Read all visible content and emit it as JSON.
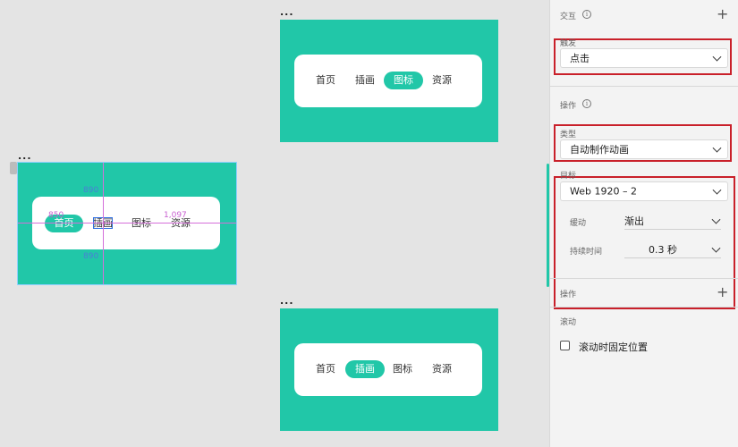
{
  "artboards": [
    {
      "label": "...",
      "nav": [
        "首页",
        "插画",
        "图标",
        "资源"
      ],
      "active_index": 2
    },
    {
      "label": "...",
      "nav": [
        "首页",
        "插画",
        "图标",
        "资源"
      ],
      "active_index": 0,
      "selected_item": "插画",
      "measurements": {
        "top": "890",
        "bottom": "890",
        "left": "850",
        "right": "1,097"
      }
    },
    {
      "label": "...",
      "nav": [
        "首页",
        "插画",
        "图标",
        "资源"
      ],
      "active_index": 1
    }
  ],
  "panel": {
    "interaction_title": "交互",
    "trigger": {
      "label": "触发",
      "value": "点击"
    },
    "action_title": "操作",
    "type": {
      "label": "类型",
      "value": "自动制作动画"
    },
    "target": {
      "label": "目标",
      "value": "Web 1920 – 2"
    },
    "easing": {
      "label": "缓动",
      "value": "渐出"
    },
    "duration": {
      "label": "持续时间",
      "value": "0.3 秒"
    },
    "action_add_label": "操作",
    "scroll": {
      "title": "滚动",
      "checkbox_label": "滚动时固定位置",
      "checked": false
    }
  },
  "colors": {
    "accent": "#21c7a8",
    "highlight_box": "#c9202a",
    "guide": "#d46fd9"
  }
}
